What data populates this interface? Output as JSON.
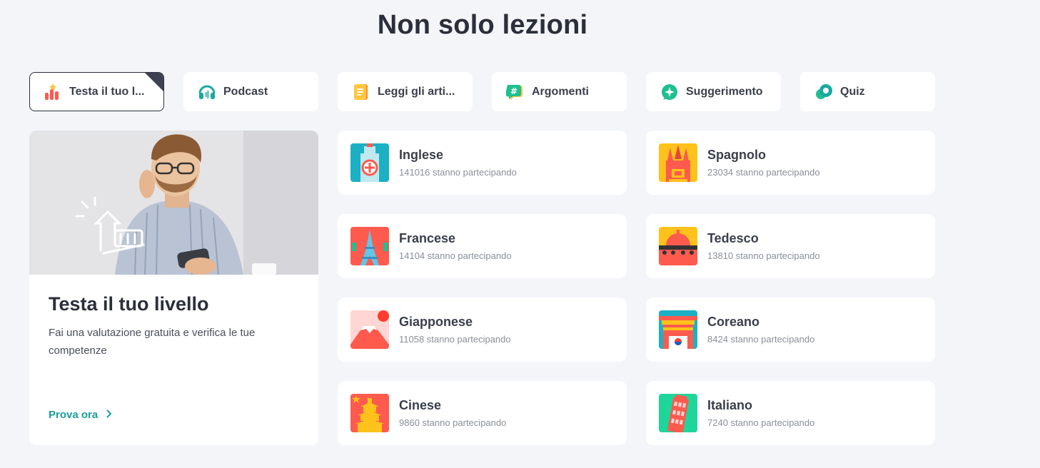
{
  "section": {
    "title": "Non solo lezioni"
  },
  "tabs": [
    {
      "label": "Testa il tuo l...",
      "icon": "level-chart-icon",
      "active": true
    },
    {
      "label": "Podcast",
      "icon": "headphones-icon",
      "active": false
    },
    {
      "label": "Leggi gli arti...",
      "icon": "article-icon",
      "active": false
    },
    {
      "label": "Argomenti",
      "icon": "hashtag-icon",
      "active": false
    },
    {
      "label": "Suggerimento",
      "icon": "sparkle-icon",
      "active": false
    },
    {
      "label": "Quiz",
      "icon": "quiz-icon",
      "active": false
    }
  ],
  "promo": {
    "title": "Testa il tuo livello",
    "description": "Fai una valutazione gratuita e verifica le tue competenze",
    "cta": "Prova ora"
  },
  "languages": [
    {
      "name": "Inglese",
      "count": "141016 stanno partecipando",
      "icon": "big-ben-icon"
    },
    {
      "name": "Spagnolo",
      "count": "23034 stanno partecipando",
      "icon": "spain-cathedral-icon"
    },
    {
      "name": "Francese",
      "count": "14104 stanno partecipando",
      "icon": "eiffel-tower-icon"
    },
    {
      "name": "Tedesco",
      "count": "13810 stanno partecipando",
      "icon": "german-dome-icon"
    },
    {
      "name": "Giapponese",
      "count": "11058 stanno partecipando",
      "icon": "mount-fuji-icon"
    },
    {
      "name": "Coreano",
      "count": "8424 stanno partecipando",
      "icon": "korean-gate-icon"
    },
    {
      "name": "Cinese",
      "count": "9860 stanno partecipando",
      "icon": "chinese-pagoda-icon"
    },
    {
      "name": "Italiano",
      "count": "7240 stanno partecipando",
      "icon": "pisa-tower-icon"
    }
  ],
  "colors": {
    "accent": "#1a9d9d",
    "background": "#f3f5f9",
    "text": "#2b2f3a"
  }
}
